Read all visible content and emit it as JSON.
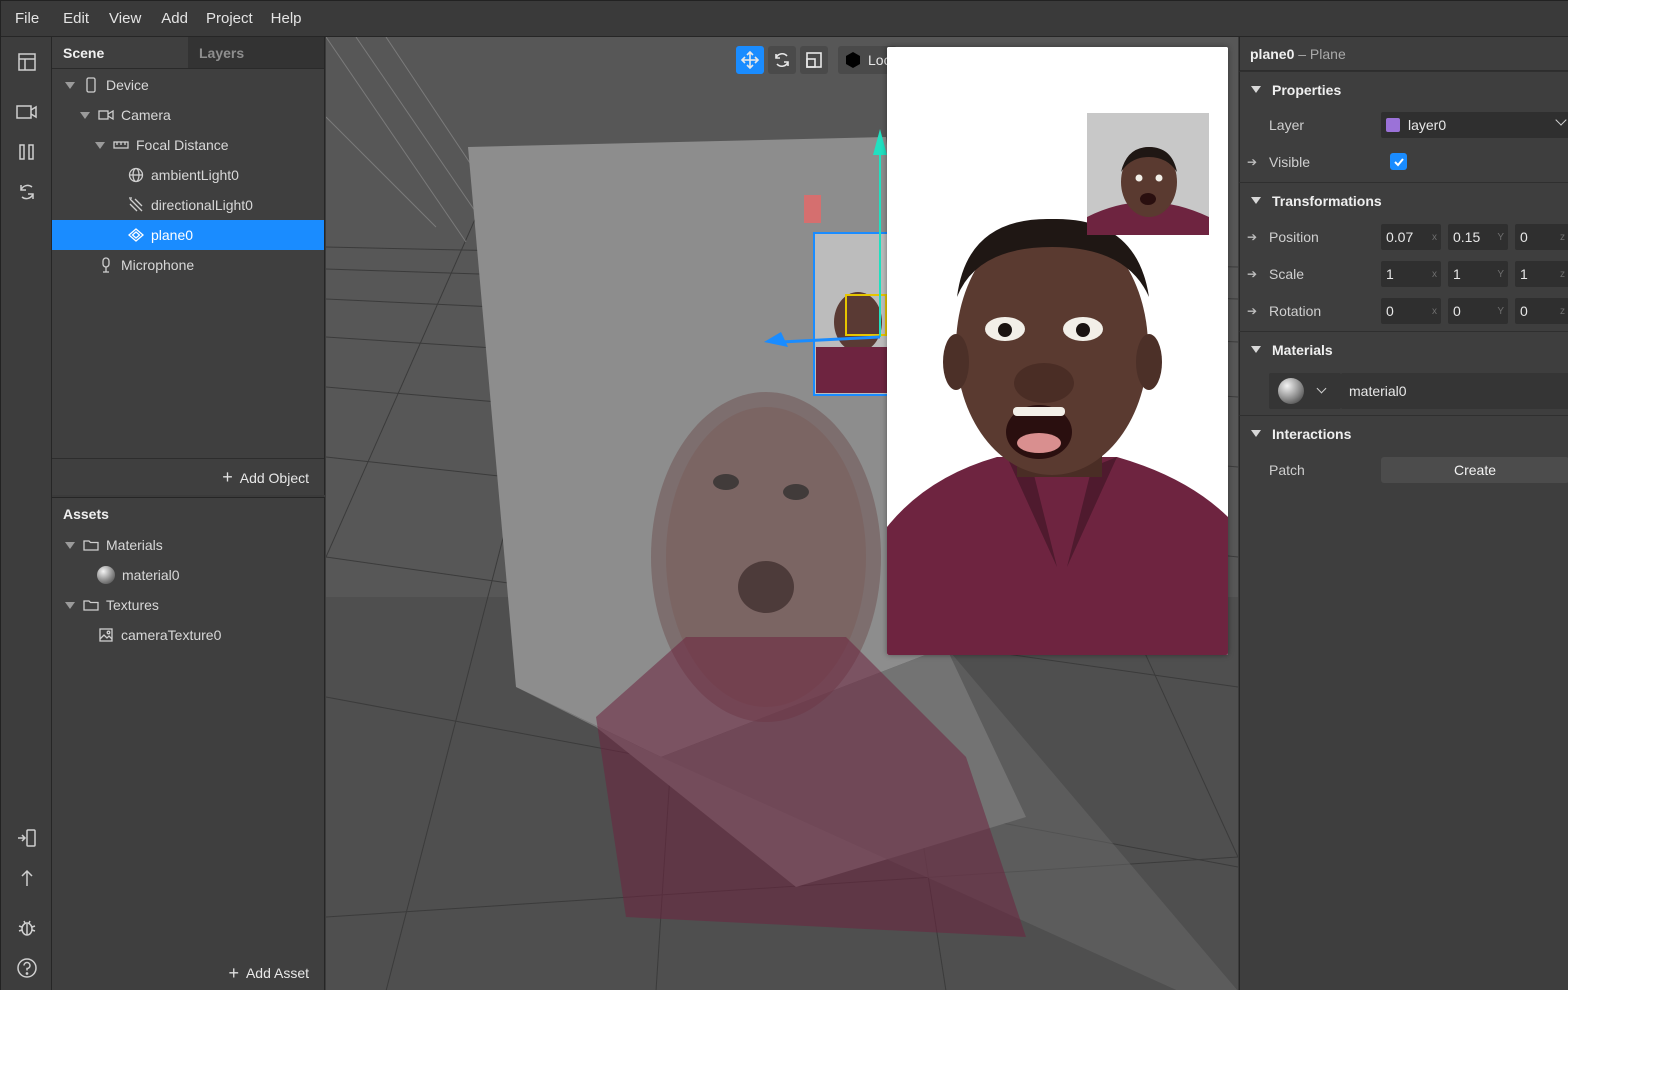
{
  "menu": [
    "File",
    "Edit",
    "View",
    "Add",
    "Project",
    "Help"
  ],
  "scene_panel": {
    "tabs": [
      "Scene",
      "Layers"
    ],
    "tree": [
      {
        "label": "Device",
        "icon": "device-icon",
        "expanded": true
      },
      {
        "label": "Camera",
        "icon": "camera-icon",
        "expanded": true
      },
      {
        "label": "Focal Distance",
        "icon": "focal-distance-icon",
        "expanded": true
      },
      {
        "label": "ambientLight0",
        "icon": "ambient-light-icon"
      },
      {
        "label": "directionalLight0",
        "icon": "directional-light-icon"
      },
      {
        "label": "plane0",
        "icon": "plane-icon",
        "selected": true
      },
      {
        "label": "Microphone",
        "icon": "microphone-icon"
      }
    ],
    "add_object": "Add Object"
  },
  "assets_panel": {
    "title": "Assets",
    "tree": [
      {
        "label": "Materials",
        "icon": "folder-icon",
        "expanded": true
      },
      {
        "label": "material0",
        "icon": "material-sphere-icon"
      },
      {
        "label": "Textures",
        "icon": "folder-icon",
        "expanded": true
      },
      {
        "label": "cameraTexture0",
        "icon": "texture-icon"
      }
    ],
    "add_asset": "Add Asset"
  },
  "viewport": {
    "toolbar_local_label": "Loc"
  },
  "inspector": {
    "object_name": "plane0",
    "object_type": "– Plane",
    "sections": {
      "properties": "Properties",
      "transformations": "Transformations",
      "materials": "Materials",
      "interactions": "Interactions"
    },
    "layer_label": "Layer",
    "layer_value": "layer0",
    "layer_color": "#9b72d8",
    "visible_label": "Visible",
    "visible_checked": true,
    "position_label": "Position",
    "position": [
      "0.07",
      "0.15",
      "0"
    ],
    "scale_label": "Scale",
    "scale": [
      "1",
      "1",
      "1"
    ],
    "rotation_label": "Rotation",
    "rotation": [
      "0",
      "0",
      "0"
    ],
    "axis_labels": [
      "x",
      "Y",
      "z"
    ],
    "material_value": "material0",
    "patch_label": "Patch",
    "create_label": "Create"
  },
  "colors": {
    "accent": "#1a8cff",
    "shirt": "#6e2440"
  }
}
